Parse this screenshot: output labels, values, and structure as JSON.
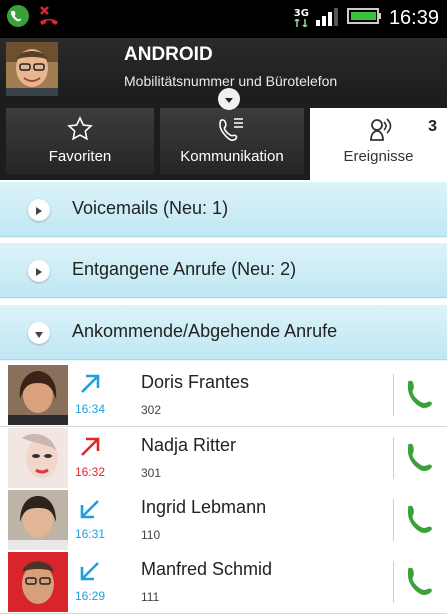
{
  "status_bar": {
    "time": "16:39",
    "network": "3G",
    "icons": [
      "call-status-icon",
      "missed-call-icon",
      "network-3g-icon",
      "signal-icon",
      "battery-icon"
    ]
  },
  "profile": {
    "name": "ANDROID",
    "subtitle": "Mobilitätsnummer und Bürotelefon"
  },
  "tabs": [
    {
      "label": "Favoriten",
      "icon": "star-icon"
    },
    {
      "label": "Kommunikation",
      "icon": "phone-list-icon"
    },
    {
      "label": "Ereignisse",
      "icon": "voicemail-icon",
      "badge": "3",
      "selected": true
    }
  ],
  "sections": [
    {
      "label": "Voicemails (Neu: 1)",
      "expanded": false
    },
    {
      "label": "Entgangene Anrufe (Neu: 2)",
      "expanded": false
    },
    {
      "label": "Ankommende/Abgehende Anrufe",
      "expanded": true
    }
  ],
  "calls": [
    {
      "name": "Doris Frantes",
      "number": "302",
      "time": "16:34",
      "direction": "outgoing",
      "color": "#1fa0dc"
    },
    {
      "name": "Nadja Ritter",
      "number": "301",
      "time": "16:32",
      "direction": "outgoing-failed",
      "color": "#e0242b"
    },
    {
      "name": "Ingrid Lebmann",
      "number": "110",
      "time": "16:31",
      "direction": "incoming",
      "color": "#1fa0dc"
    },
    {
      "name": "Manfred Schmid",
      "number": "111",
      "time": "16:29",
      "direction": "incoming",
      "color": "#1fa0dc"
    }
  ],
  "colors": {
    "accent_blue": "#1fa0dc",
    "missed_red": "#e0242b",
    "call_green": "#3aa13a",
    "section_bg": "#cdeef7"
  }
}
